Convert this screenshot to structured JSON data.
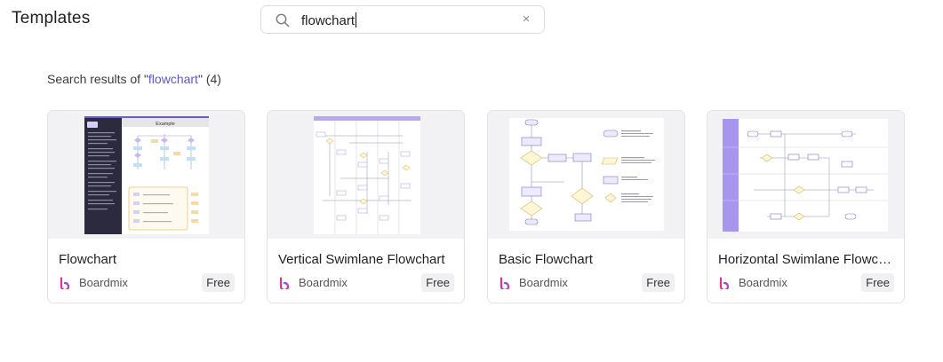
{
  "header": {
    "title": "Templates"
  },
  "search": {
    "value": "flowchart",
    "clear_icon": "close-icon",
    "icon": "search-icon"
  },
  "results": {
    "prefix": "Search results of \"",
    "query": "flowchart",
    "suffix": "\" (4)"
  },
  "cards": [
    {
      "title": "Flowchart",
      "brand": "Boardmix",
      "badge": "Free",
      "thumb_label": "Example"
    },
    {
      "title": "Vertical Swimlane Flowchart",
      "brand": "Boardmix",
      "badge": "Free"
    },
    {
      "title": "Basic Flowchart",
      "brand": "Boardmix",
      "badge": "Free"
    },
    {
      "title": "Horizontal Swimlane Flowch...",
      "brand": "Boardmix",
      "badge": "Free"
    }
  ],
  "colors": {
    "accent": "#5b57d1",
    "brand_logo": "#e0309a"
  }
}
